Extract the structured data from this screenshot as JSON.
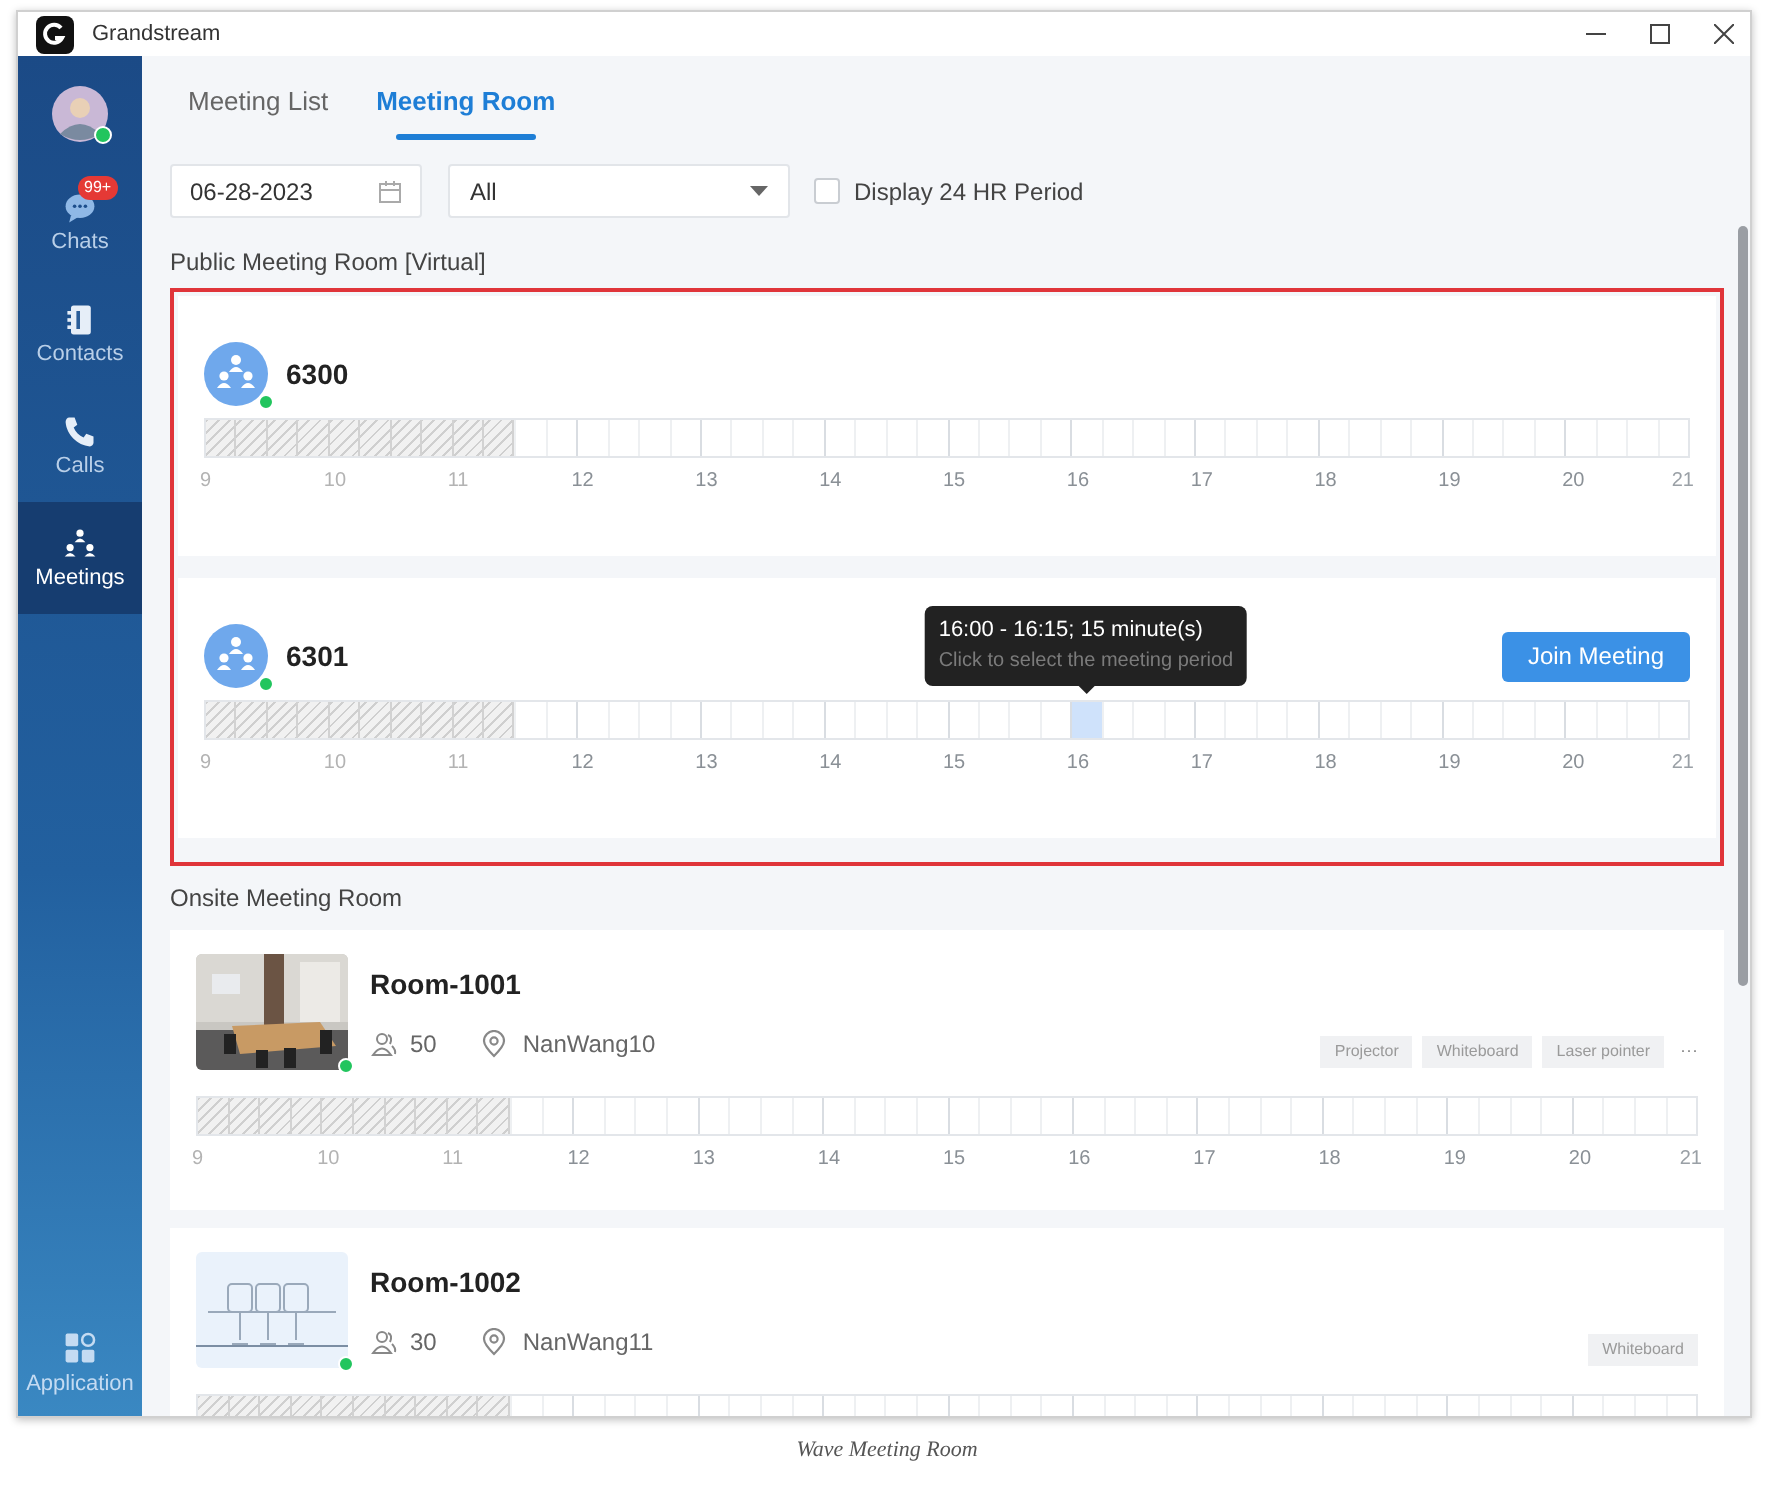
{
  "window": {
    "title": "Grandstream"
  },
  "sidebar": {
    "avatar": {
      "online": true
    },
    "items": [
      {
        "kind": "chat",
        "label": "Chats",
        "badge": "99+",
        "selected": false
      },
      {
        "kind": "contacts",
        "label": "Contacts",
        "selected": false
      },
      {
        "kind": "calls",
        "label": "Calls",
        "selected": false
      },
      {
        "kind": "meetings",
        "label": "Meetings",
        "selected": true
      }
    ],
    "bottom_item": {
      "kind": "apps",
      "label": "Application"
    }
  },
  "tabs": [
    {
      "label": "Meeting List",
      "selected": false
    },
    {
      "label": "Meeting Room",
      "selected": true
    }
  ],
  "filters": {
    "date": "06-28-2023",
    "type_select": "All",
    "checkbox": {
      "label": "Display 24 HR Period",
      "checked": false
    }
  },
  "public_section": {
    "title": "Public Meeting Room [Virtual]",
    "rooms": [
      {
        "name": "6300",
        "online": true,
        "timeline": {
          "level": 0.208,
          "hours": [
            {
              "label": "9",
              "selected": false
            },
            {
              "label": "10",
              "selected": false
            },
            {
              "label": "11",
              "selected": false
            },
            {
              "label": "12",
              "selected": false
            },
            {
              "label": "13",
              "selected": false
            },
            {
              "label": "14",
              "selected": false
            },
            {
              "label": "15",
              "selected": false
            },
            {
              "label": "16",
              "selected": false
            },
            {
              "label": "17",
              "selected": false
            },
            {
              "label": "18",
              "selected": false
            },
            {
              "label": "19",
              "selected": false
            },
            {
              "label": "20",
              "selected": false
            }
          ],
          "end_label": "21"
        }
      },
      {
        "name": "6301",
        "online": true,
        "join_button": "Join Meeting",
        "tooltip": {
          "title": "16:00 - 16:15; 15 minute(s)",
          "hint": "Click to select the meeting period"
        },
        "timeline": {
          "level": 0.208,
          "hours": [
            {
              "label": "9",
              "selected": false
            },
            {
              "label": "10",
              "selected": false
            },
            {
              "label": "11",
              "selected": false
            },
            {
              "label": "12",
              "selected": false
            },
            {
              "label": "13",
              "selected": false
            },
            {
              "label": "14",
              "selected": false
            },
            {
              "label": "15",
              "selected": false
            },
            {
              "label": "16",
              "selected": true
            },
            {
              "label": "17",
              "selected": false
            },
            {
              "label": "18",
              "selected": false
            },
            {
              "label": "19",
              "selected": false
            },
            {
              "label": "20",
              "selected": false
            }
          ],
          "end_label": "21"
        }
      }
    ]
  },
  "onsite_section": {
    "title": "Onsite Meeting Room",
    "rooms": [
      {
        "name": "Room-1001",
        "online": true,
        "capacity": "50",
        "location": "NanWang10",
        "tags": [
          "Projector",
          "Whiteboard",
          "Laser pointer"
        ],
        "more": "···",
        "timeline": {
          "level": 0.208,
          "hours": [
            {
              "label": "9",
              "selected": false
            },
            {
              "label": "10",
              "selected": false
            },
            {
              "label": "11",
              "selected": false
            },
            {
              "label": "12",
              "selected": false
            },
            {
              "label": "13",
              "selected": false
            },
            {
              "label": "14",
              "selected": false
            },
            {
              "label": "15",
              "selected": false
            },
            {
              "label": "16",
              "selected": false
            },
            {
              "label": "17",
              "selected": false
            },
            {
              "label": "18",
              "selected": false
            },
            {
              "label": "19",
              "selected": false
            },
            {
              "label": "20",
              "selected": false
            }
          ],
          "end_label": "21"
        }
      },
      {
        "name": "Room-1002",
        "online": true,
        "kind": "illustration",
        "capacity": "30",
        "location": "NanWang11",
        "tags": [
          "Whiteboard"
        ],
        "timeline": {
          "level": 0.208,
          "hours": [
            {
              "selected": false
            },
            {
              "selected": false
            },
            {
              "selected": false
            },
            {
              "selected": false
            },
            {
              "selected": false
            },
            {
              "selected": false
            },
            {
              "selected": false
            },
            {
              "selected": false
            },
            {
              "selected": false
            },
            {
              "selected": false
            },
            {
              "selected": false
            },
            {
              "selected": false
            }
          ]
        }
      }
    ]
  },
  "caption": "Wave Meeting Room"
}
